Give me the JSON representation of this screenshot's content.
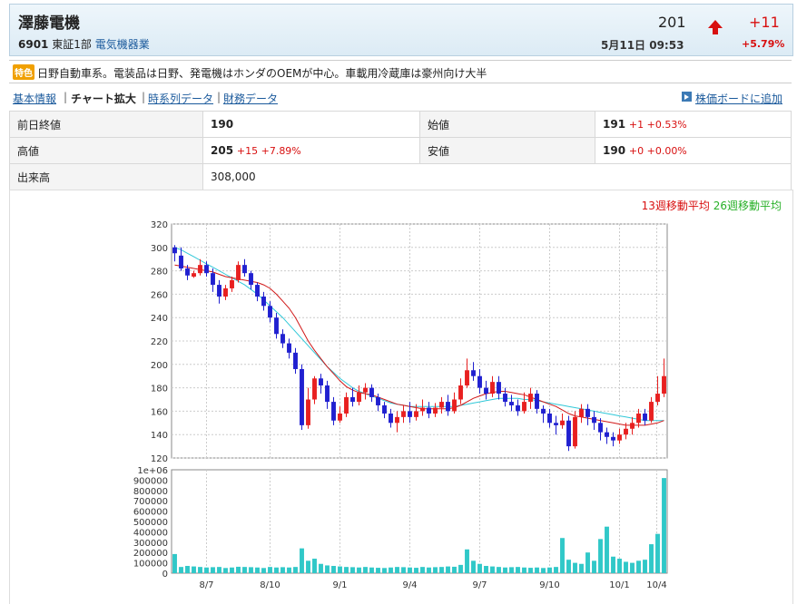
{
  "header": {
    "company": "澤藤電機",
    "code": "6901",
    "market": "東証1部",
    "sector": "電気機器業",
    "price": "201",
    "change": "+11",
    "change_pct": "+5.79%",
    "datetime": "5月11日 09:53"
  },
  "feature": {
    "tag": "特色",
    "text": "日野自動車系。電装品は日野、発電機はホンダのOEMが中心。車載用冷蔵庫は豪州向け大半"
  },
  "nav": {
    "basic": "基本情報",
    "chart": "チャート拡大",
    "timeseries": "時系列データ",
    "financial": "財務データ",
    "sep": "|",
    "board": "株価ボードに追加"
  },
  "quote": {
    "prev_close_label": "前日終値",
    "prev_close": "190",
    "open_label": "始値",
    "open": "191",
    "open_diff": "+1 +0.53%",
    "high_label": "高値",
    "high": "205",
    "high_diff": "+15 +7.89%",
    "low_label": "安値",
    "low": "190",
    "low_diff": "+0 +0.00%",
    "volume_label": "出来高",
    "volume": "308,000"
  },
  "legend": {
    "ma13": "13週移動平均",
    "ma26": "26週移動平均"
  },
  "colors": {
    "up": "#e82020",
    "down": "#2020d0",
    "ma13": "#d01818",
    "ma26": "#30c8d8",
    "volume": "#30c8c8"
  },
  "chart_data": {
    "type": "candlestick",
    "price_ylim": [
      120,
      320
    ],
    "price_ticks": [
      "320",
      "300",
      "280",
      "260",
      "240",
      "220",
      "200",
      "180",
      "160",
      "140",
      "120"
    ],
    "volume_ylim": [
      0,
      1000000
    ],
    "volume_ticks": [
      "1e+06",
      "900000",
      "800000",
      "700000",
      "600000",
      "500000",
      "400000",
      "300000",
      "200000",
      "100000",
      "0"
    ],
    "x_labels": [
      "8/7",
      "8/10",
      "9/1",
      "9/4",
      "9/7",
      "9/10",
      "10/1",
      "10/4"
    ],
    "candles": [
      [
        0,
        300,
        295,
        302,
        288
      ],
      [
        1,
        293,
        282,
        300,
        280
      ],
      [
        2,
        282,
        276,
        285,
        272
      ],
      [
        3,
        275,
        278,
        280,
        274
      ],
      [
        4,
        278,
        285,
        290,
        276
      ],
      [
        5,
        285,
        278,
        288,
        275
      ],
      [
        6,
        278,
        268,
        282,
        262
      ],
      [
        7,
        268,
        258,
        272,
        252
      ],
      [
        8,
        258,
        265,
        268,
        255
      ],
      [
        9,
        265,
        272,
        275,
        262
      ],
      [
        10,
        272,
        285,
        288,
        270
      ],
      [
        11,
        285,
        278,
        290,
        275
      ],
      [
        12,
        278,
        268,
        280,
        264
      ],
      [
        13,
        268,
        258,
        270,
        254
      ],
      [
        14,
        258,
        250,
        262,
        246
      ],
      [
        15,
        250,
        240,
        254,
        236
      ],
      [
        16,
        240,
        226,
        244,
        222
      ],
      [
        17,
        226,
        218,
        230,
        214
      ],
      [
        18,
        218,
        210,
        222,
        205
      ],
      [
        19,
        210,
        196,
        214,
        192
      ],
      [
        20,
        196,
        148,
        200,
        144
      ],
      [
        21,
        148,
        170,
        180,
        145
      ],
      [
        22,
        170,
        188,
        190,
        166
      ],
      [
        23,
        188,
        182,
        192,
        175
      ],
      [
        24,
        182,
        168,
        186,
        162
      ],
      [
        25,
        168,
        152,
        172,
        148
      ],
      [
        26,
        152,
        158,
        164,
        150
      ],
      [
        27,
        158,
        172,
        176,
        155
      ],
      [
        28,
        172,
        168,
        180,
        164
      ],
      [
        29,
        168,
        176,
        182,
        165
      ],
      [
        30,
        176,
        180,
        184,
        170
      ],
      [
        31,
        180,
        172,
        183,
        168
      ],
      [
        32,
        172,
        165,
        175,
        160
      ],
      [
        33,
        165,
        158,
        168,
        154
      ],
      [
        34,
        158,
        150,
        162,
        146
      ],
      [
        35,
        150,
        155,
        160,
        142
      ],
      [
        36,
        155,
        160,
        165,
        150
      ],
      [
        37,
        160,
        155,
        168,
        150
      ],
      [
        38,
        155,
        160,
        166,
        152
      ],
      [
        39,
        160,
        163,
        170,
        156
      ],
      [
        40,
        163,
        158,
        168,
        154
      ],
      [
        41,
        158,
        163,
        167,
        155
      ],
      [
        42,
        163,
        168,
        172,
        158
      ],
      [
        43,
        168,
        160,
        174,
        156
      ],
      [
        44,
        160,
        170,
        176,
        158
      ],
      [
        45,
        170,
        182,
        188,
        166
      ],
      [
        46,
        182,
        195,
        205,
        180
      ],
      [
        47,
        195,
        190,
        202,
        186
      ],
      [
        48,
        190,
        180,
        196,
        175
      ],
      [
        49,
        180,
        175,
        186,
        170
      ],
      [
        50,
        175,
        185,
        190,
        172
      ],
      [
        51,
        185,
        175,
        190,
        170
      ],
      [
        52,
        175,
        168,
        180,
        164
      ],
      [
        53,
        168,
        165,
        174,
        160
      ],
      [
        54,
        165,
        160,
        170,
        156
      ],
      [
        55,
        160,
        168,
        176,
        158
      ],
      [
        56,
        168,
        175,
        180,
        162
      ],
      [
        57,
        175,
        162,
        178,
        158
      ],
      [
        58,
        162,
        158,
        165,
        150
      ],
      [
        59,
        158,
        150,
        162,
        146
      ],
      [
        60,
        150,
        148,
        156,
        140
      ],
      [
        61,
        148,
        152,
        158,
        145
      ],
      [
        62,
        152,
        130,
        156,
        126
      ],
      [
        63,
        130,
        155,
        160,
        128
      ],
      [
        64,
        155,
        162,
        166,
        150
      ],
      [
        65,
        162,
        155,
        166,
        148
      ],
      [
        66,
        155,
        150,
        160,
        144
      ],
      [
        67,
        150,
        142,
        154,
        135
      ],
      [
        68,
        142,
        138,
        146,
        132
      ],
      [
        69,
        138,
        135,
        142,
        130
      ],
      [
        70,
        135,
        140,
        145,
        132
      ],
      [
        71,
        140,
        145,
        150,
        136
      ],
      [
        72,
        145,
        150,
        155,
        140
      ],
      [
        73,
        150,
        158,
        162,
        146
      ],
      [
        74,
        158,
        152,
        162,
        148
      ],
      [
        75,
        152,
        168,
        172,
        150
      ],
      [
        76,
        168,
        175,
        190,
        165
      ],
      [
        77,
        175,
        190,
        205,
        172
      ]
    ],
    "volumes": [
      185000,
      60000,
      70000,
      65000,
      60000,
      55000,
      58000,
      60000,
      50000,
      55000,
      62000,
      60000,
      58000,
      55000,
      50000,
      60000,
      55000,
      58000,
      55000,
      60000,
      240000,
      120000,
      140000,
      90000,
      75000,
      70000,
      65000,
      60000,
      58000,
      55000,
      60000,
      55000,
      52000,
      50000,
      55000,
      60000,
      58000,
      55000,
      52000,
      60000,
      55000,
      58000,
      60000,
      65000,
      62000,
      80000,
      230000,
      120000,
      90000,
      70000,
      65000,
      60000,
      55000,
      58000,
      60000,
      55000,
      52000,
      55000,
      50000,
      55000,
      60000,
      340000,
      130000,
      100000,
      90000,
      200000,
      120000,
      330000,
      450000,
      160000,
      140000,
      110000,
      100000,
      120000,
      130000,
      280000,
      380000,
      920000
    ],
    "ma13": [
      285,
      284,
      283,
      282,
      281,
      280,
      279,
      277,
      275,
      274,
      273,
      272,
      271,
      270,
      268,
      265,
      260,
      254,
      248,
      240,
      230,
      220,
      212,
      205,
      198,
      192,
      186,
      181,
      178,
      176,
      175,
      174,
      172,
      170,
      168,
      166,
      165,
      164,
      163,
      162,
      162,
      162,
      162,
      162,
      163,
      165,
      168,
      171,
      173,
      175,
      176,
      177,
      177,
      176,
      175,
      174,
      172,
      170,
      168,
      166,
      164,
      161,
      158,
      156,
      155,
      154,
      153,
      152,
      151,
      150,
      149,
      148,
      148,
      148,
      148,
      149,
      150,
      152
    ],
    "ma26": [
      300,
      298,
      295,
      292,
      289,
      286,
      283,
      280,
      277,
      274,
      271,
      268,
      264,
      260,
      255,
      250,
      245,
      240,
      234,
      228,
      222,
      216,
      210,
      204,
      198,
      193,
      188,
      184,
      180,
      177,
      175,
      173,
      171,
      169,
      167,
      166,
      165,
      164,
      164,
      164,
      164,
      164,
      164,
      164,
      164,
      165,
      166,
      167,
      168,
      169,
      170,
      171,
      171,
      171,
      171,
      170,
      170,
      169,
      168,
      167,
      166,
      165,
      164,
      163,
      162,
      161,
      160,
      159,
      158,
      157,
      156,
      155,
      154,
      153,
      152,
      152,
      152,
      152
    ]
  }
}
